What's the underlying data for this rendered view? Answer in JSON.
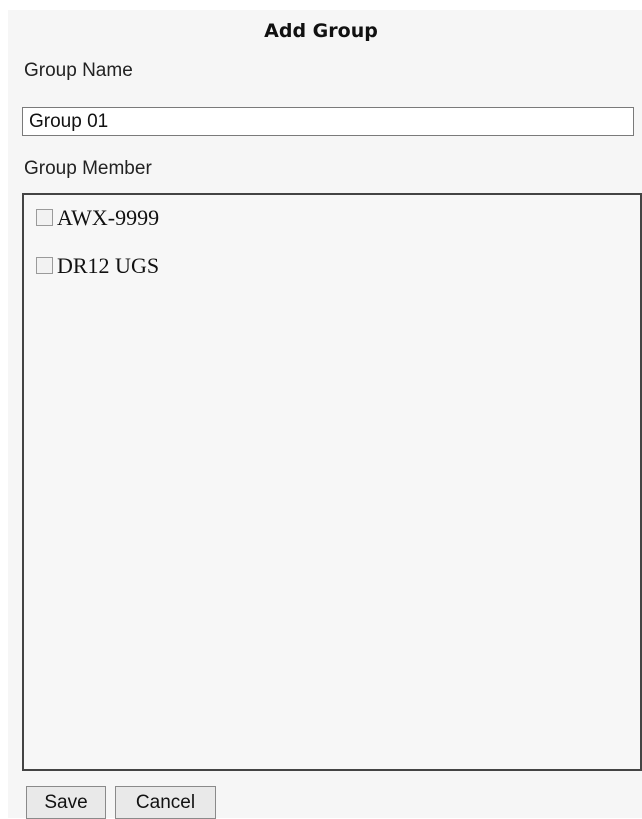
{
  "dialog": {
    "title": "Add Group"
  },
  "group_name": {
    "label": "Group Name",
    "value": "Group 01"
  },
  "group_member": {
    "label": "Group Member",
    "items": [
      {
        "label": "AWX-9999",
        "checked": false
      },
      {
        "label": "DR12 UGS",
        "checked": false
      }
    ]
  },
  "buttons": {
    "save_label": "Save",
    "cancel_label": "Cancel"
  }
}
